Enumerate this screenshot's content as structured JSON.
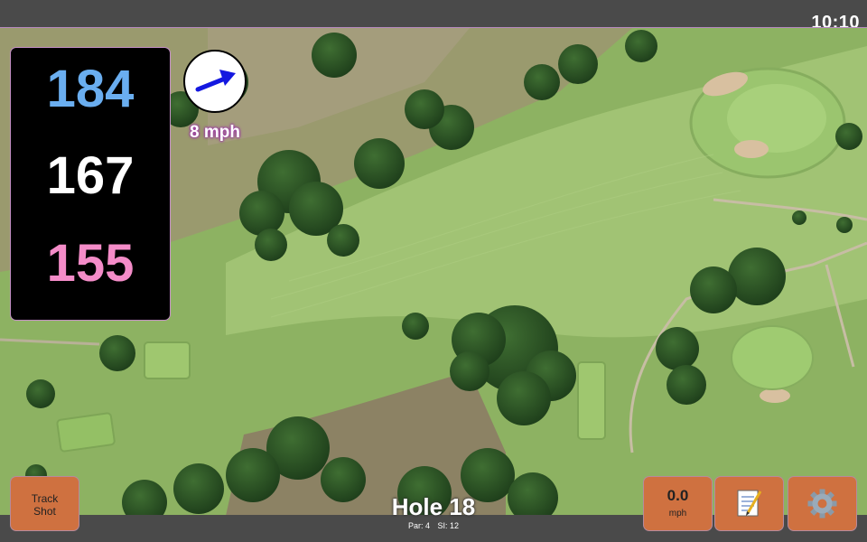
{
  "status_bar": {
    "time": "10:10"
  },
  "distances": {
    "back": "184",
    "middle": "167",
    "front": "155",
    "colors": {
      "back": "#6aaef0",
      "middle": "#ffffff",
      "front": "#f48cc8"
    }
  },
  "wind": {
    "speed": "8 mph",
    "arrow_color": "#1418e0"
  },
  "buttons": {
    "track_shot_line1": "Track",
    "track_shot_line2": "Shot",
    "speed_value": "0.0",
    "speed_unit": "mph"
  },
  "icons": {
    "notes": "memo-icon",
    "settings": "gear-icon"
  },
  "hole": {
    "title": "Hole 18",
    "par": "Par: 4",
    "si": "SI: 12"
  },
  "colors": {
    "button_bg": "#cf7140",
    "bar_bg": "#4a4a4a",
    "panel_bg": "#000000"
  }
}
